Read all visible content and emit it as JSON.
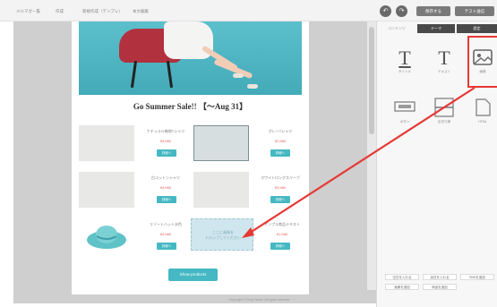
{
  "header": {
    "breadcrumbs": [
      "メルマガー覧",
      "作成",
      "新規作成（テンプレ）",
      "本文編集"
    ],
    "undo_icon": "undo-icon",
    "redo_icon": "redo-icon",
    "buttons": [
      "保存する",
      "テスト送信"
    ]
  },
  "panel": {
    "tabs": [
      "コンテンツ",
      "テーマ",
      "設定"
    ],
    "tools": [
      {
        "label": "タイトル",
        "glyph": "T"
      },
      {
        "label": "テキスト",
        "glyph": "T"
      },
      {
        "label": "画像",
        "icon": "image-icon"
      },
      {
        "label": "ボタン",
        "icon": "button-block-icon"
      },
      {
        "label": "区切り線",
        "icon": "divider-icon"
      },
      {
        "label": "HTML",
        "icon": "html-icon"
      }
    ],
    "links": [
      "空白を入れる",
      "余白を入れる",
      "SNSを追加",
      "画像を追加",
      "商品を追加"
    ]
  },
  "email": {
    "title": "Go Summer Sale!! 【〜Aug 31】",
    "products": [
      {
        "name": "ナチュラル無地Tシャツ",
        "price": "¥3,980",
        "button": "詳細へ"
      },
      {
        "name": "グレーTシャツ",
        "price": "¥2,980",
        "button": "詳細へ"
      },
      {
        "name": "白コットンシャツ",
        "price": "¥4,980",
        "button": "詳細へ"
      },
      {
        "name": "ホワイトロングスリーブ",
        "price": "¥3,980",
        "button": "詳細へ"
      },
      {
        "name": "リゾートハット水色",
        "price": "¥2,980",
        "button": "詳細へ"
      },
      {
        "name": "サンプル商品テキスト",
        "price": "¥1,980",
        "button": "詳細へ"
      }
    ],
    "drop_text": "ここに画像を\nドロップしてください",
    "show_button": "Show products"
  },
  "footer": {
    "note": "Copyright © Shop Name. All rights reserved."
  },
  "colors": {
    "accent": "#45b8c3",
    "highlight": "#e53935",
    "price": "#e06060"
  }
}
